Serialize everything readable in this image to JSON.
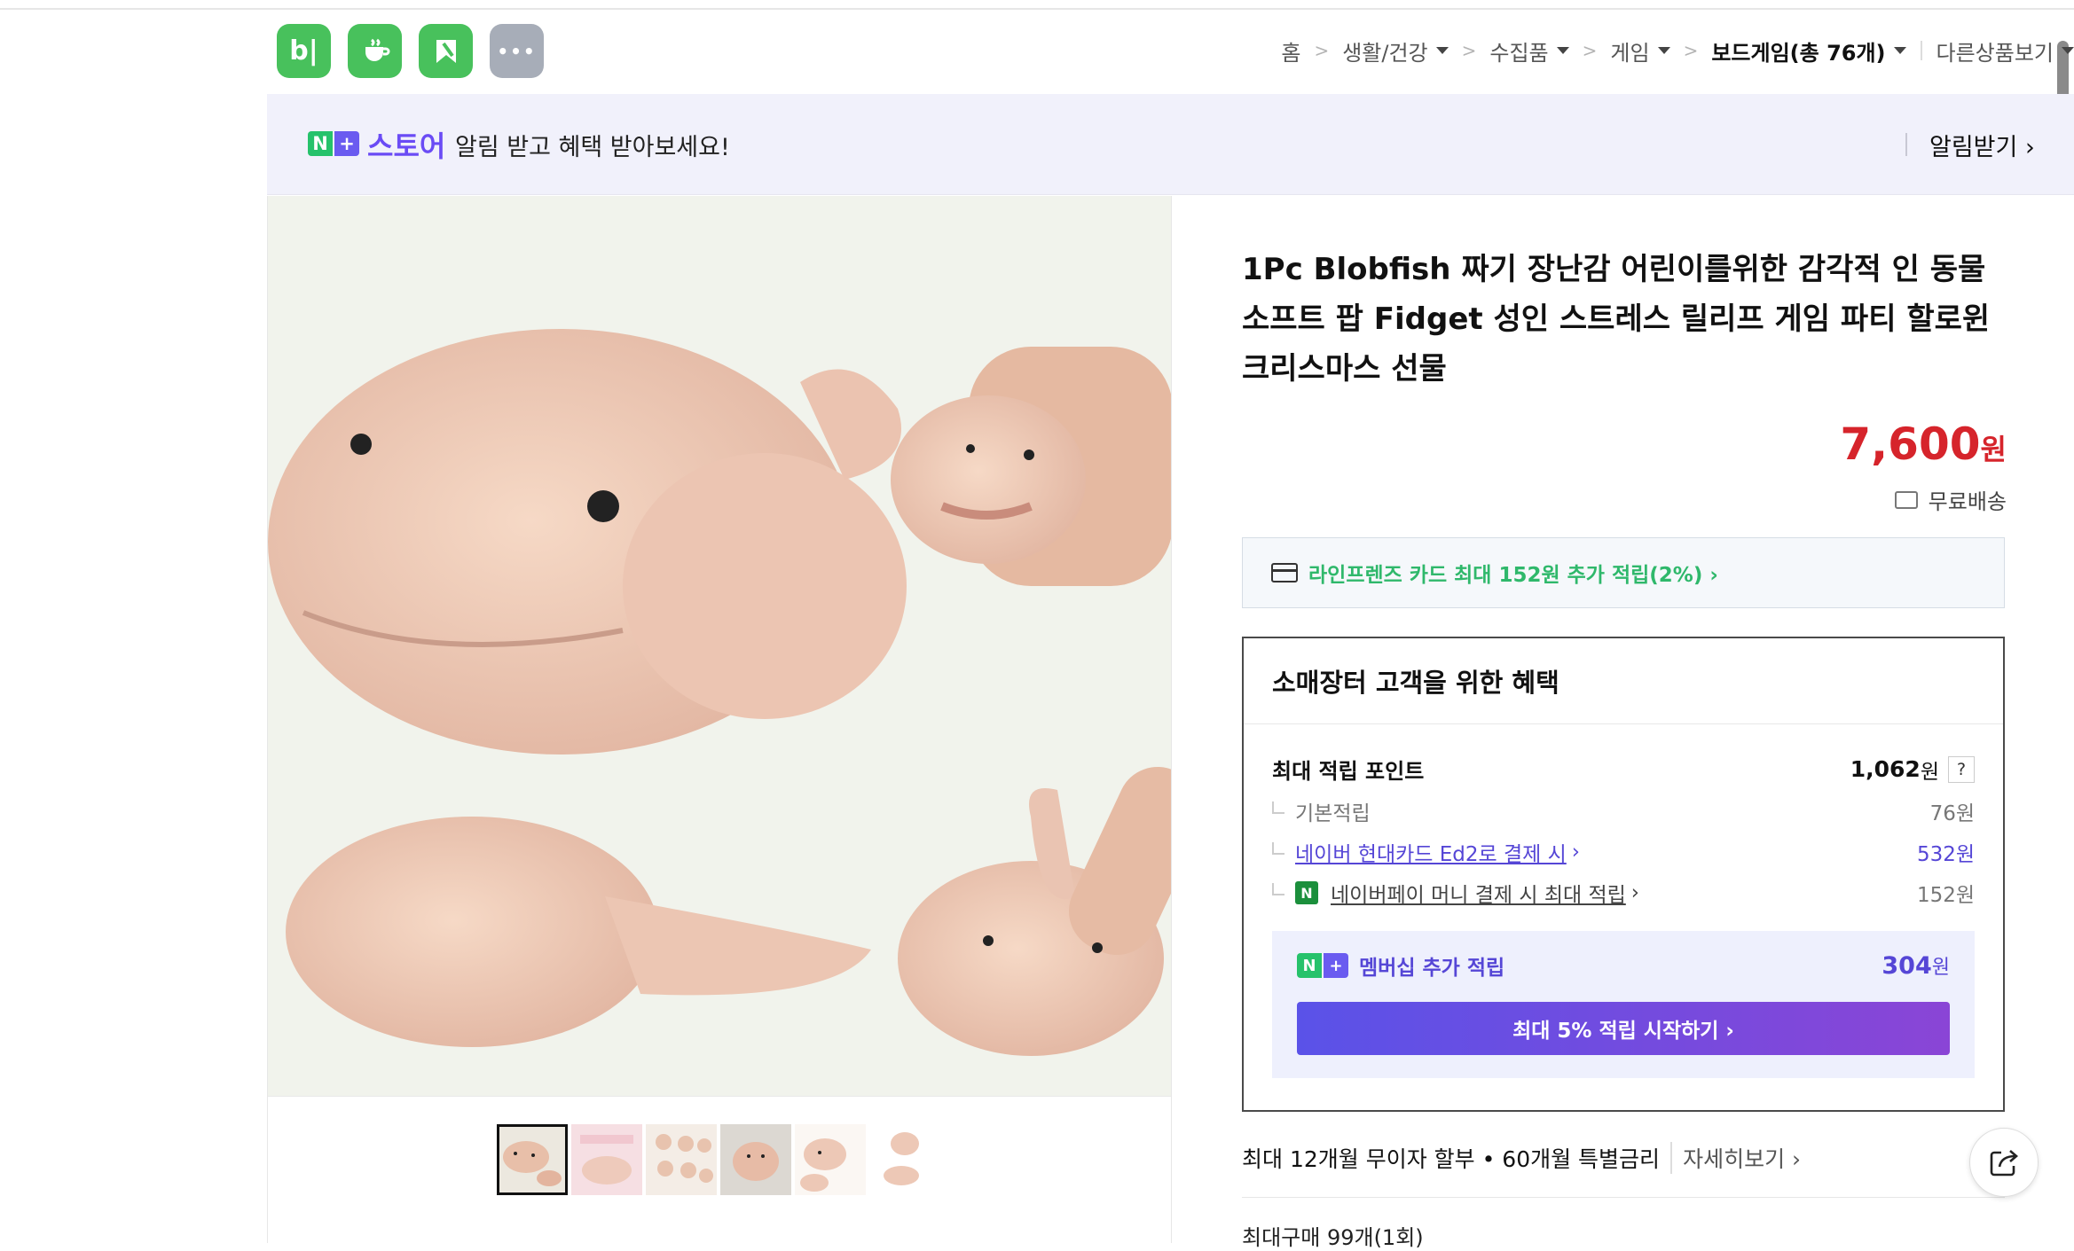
{
  "apps": [
    {
      "name": "blog",
      "glyph": "b|"
    },
    {
      "name": "cafe",
      "glyph": ""
    },
    {
      "name": "bookmark",
      "glyph": ""
    },
    {
      "name": "more",
      "glyph": "•••"
    }
  ],
  "breadcrumb": {
    "home": "홈",
    "items": [
      "생활/건강",
      "수집품",
      "게임"
    ],
    "current": "보드게임(총 76개)",
    "other": "다른상품보기"
  },
  "banner": {
    "badge_n": "N",
    "badge_plus": "+",
    "store": "스토어",
    "message": "알림 받고 혜택 받아보세요!",
    "action": "알림받기 ›"
  },
  "product": {
    "title": "1Pc Blobfish 짜기 장난감 어린이를위한 감각적 인 동물 소프트 팝 Fidget 성인 스트레스 릴리프 게임 파티 할로윈 크리스마스 선물",
    "price": "7,600",
    "currency": "원",
    "shipping": "무료배송",
    "card_offer": "라인프렌즈 카드 최대 152원 추가 적립(2%) ›"
  },
  "benefits": {
    "heading": "소매장터 고객을 위한 혜택",
    "max_points_label": "최대 적립 포인트",
    "max_points_value": "1,062",
    "max_points_unit": "원",
    "help": "?",
    "rows": [
      {
        "label": "기본적립",
        "value": "76원"
      },
      {
        "label": "네이버 현대카드 Ed2로 결제 시",
        "value": "532원"
      },
      {
        "label": "네이버페이 머니 결제 시 최대 적립",
        "value": "152원"
      }
    ],
    "membership_label": "멤버십 추가 적립",
    "membership_value": "304",
    "membership_unit": "원",
    "membership_button": "최대 5% 적립 시작하기 ›"
  },
  "installment": {
    "text": "최대 12개월 무이자 할부 • 60개월 특별금리",
    "more": "자세히보기 ›"
  },
  "max_purchase": "최대구매 99개(1회)",
  "colors": {
    "brand_green": "#48c15c",
    "price_red": "#d6242b",
    "membership_purple": "#5546d6"
  }
}
